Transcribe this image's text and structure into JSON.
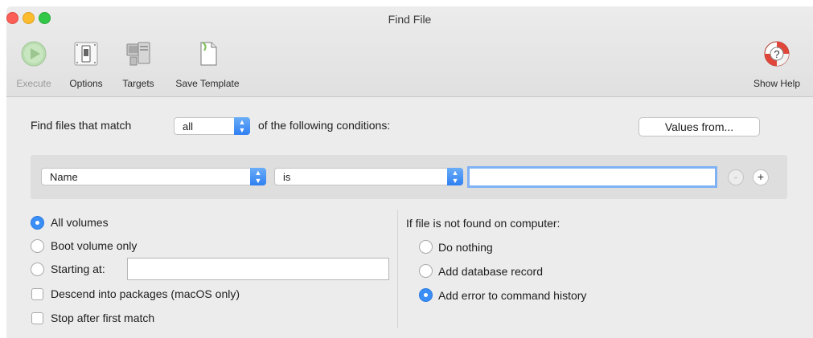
{
  "window": {
    "title": "Find File"
  },
  "toolbar": {
    "execute": "Execute",
    "options": "Options",
    "targets": "Targets",
    "save_template": "Save Template",
    "show_help": "Show Help"
  },
  "match": {
    "prefix": "Find files that match",
    "mode": "all",
    "suffix": "of the following conditions:",
    "values_from": "Values from..."
  },
  "condition": {
    "field": "Name",
    "operator": "is",
    "value": "",
    "remove": "-",
    "add": "+"
  },
  "scope": {
    "all_volumes": "All volumes",
    "boot_volume": "Boot volume only",
    "starting_at": "Starting at:",
    "starting_at_value": "",
    "selected": "All volumes"
  },
  "options": {
    "descend": "Descend into packages (macOS only)",
    "stop_first": "Stop after first match"
  },
  "not_found": {
    "heading": "If file is not found on computer:",
    "do_nothing": "Do nothing",
    "add_record": "Add database record",
    "add_error": "Add error to command history",
    "selected": "Add error to command history"
  }
}
